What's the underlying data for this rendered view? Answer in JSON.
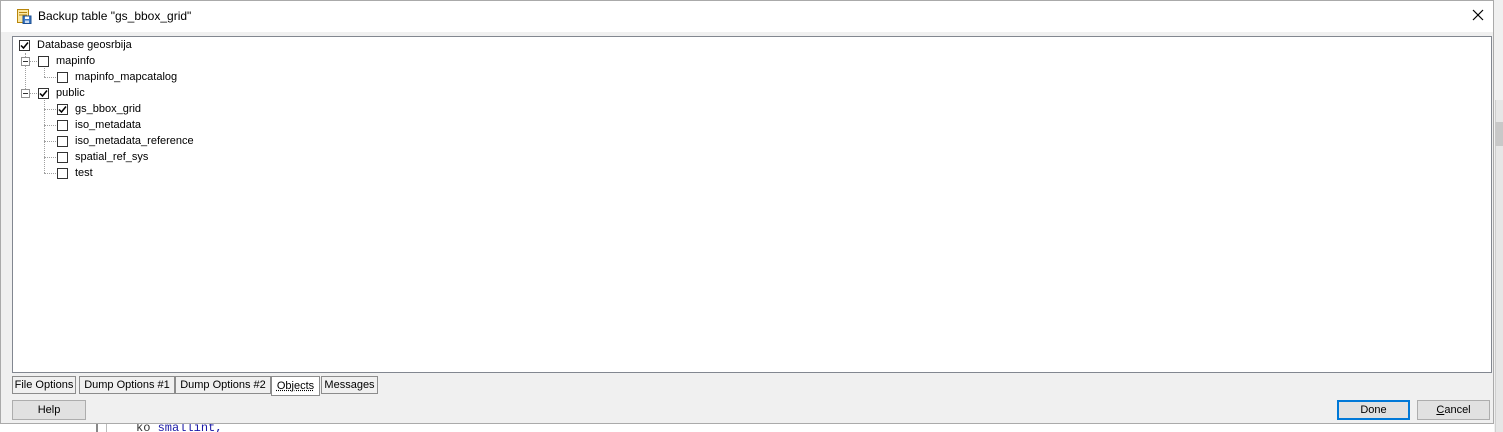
{
  "dialog": {
    "title": "Backup table \"gs_bbox_grid\"",
    "icon": "backup-table-icon",
    "close_icon": "close-icon"
  },
  "tree": {
    "items": [
      {
        "label": "Database geosrbija",
        "checked": true
      },
      {
        "label": "mapinfo",
        "checked": false,
        "expanded": true
      },
      {
        "label": "mapinfo_mapcatalog",
        "checked": false
      },
      {
        "label": "public",
        "checked": true,
        "expanded": true
      },
      {
        "label": "gs_bbox_grid",
        "checked": true
      },
      {
        "label": "iso_metadata",
        "checked": false
      },
      {
        "label": "iso_metadata_reference",
        "checked": false
      },
      {
        "label": "spatial_ref_sys",
        "checked": false
      },
      {
        "label": "test",
        "checked": false
      }
    ]
  },
  "tabs": [
    {
      "label": "File Options",
      "active": false
    },
    {
      "label": "Dump Options #1",
      "active": false
    },
    {
      "label": "Dump Options #2",
      "active": false
    },
    {
      "label": "Objects",
      "active": true
    },
    {
      "label": "Messages",
      "active": false
    }
  ],
  "buttons": {
    "help": "Help",
    "done": "Done",
    "cancel_accel": "C",
    "cancel_rest": "ancel"
  },
  "background": {
    "code_indent": "ko",
    "code_type": "smallint,"
  },
  "colors": {
    "default_button_border": "#0078d7",
    "checkmark": "#000000"
  }
}
